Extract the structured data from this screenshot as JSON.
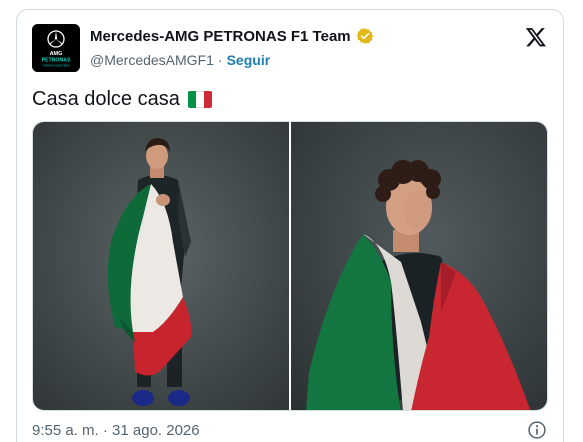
{
  "tweet": {
    "author": {
      "display_name": "Mercedes-AMG PETRONAS F1 Team",
      "handle": "@MercedesAMGF1",
      "separator": "·",
      "follow_label": "Seguir",
      "verified_color": "#e2b719"
    },
    "avatar": {
      "brand_text_1": "AMG",
      "brand_text_2": "PETRONAS",
      "brand_text_3": "FORMULA ONE TEAM",
      "accent": "#00d2be"
    },
    "text": "Casa dolce casa",
    "flag_emoji": "italy-flag",
    "flag_colors": [
      "#009246",
      "#ffffff",
      "#ce2b37"
    ],
    "timestamp": "9:55 a. m. · 31 ago. 2026",
    "media_count": 2
  },
  "icons": {
    "platform_logo": "x-logo-icon",
    "info": "info-icon",
    "verified": "verified-badge-icon"
  }
}
